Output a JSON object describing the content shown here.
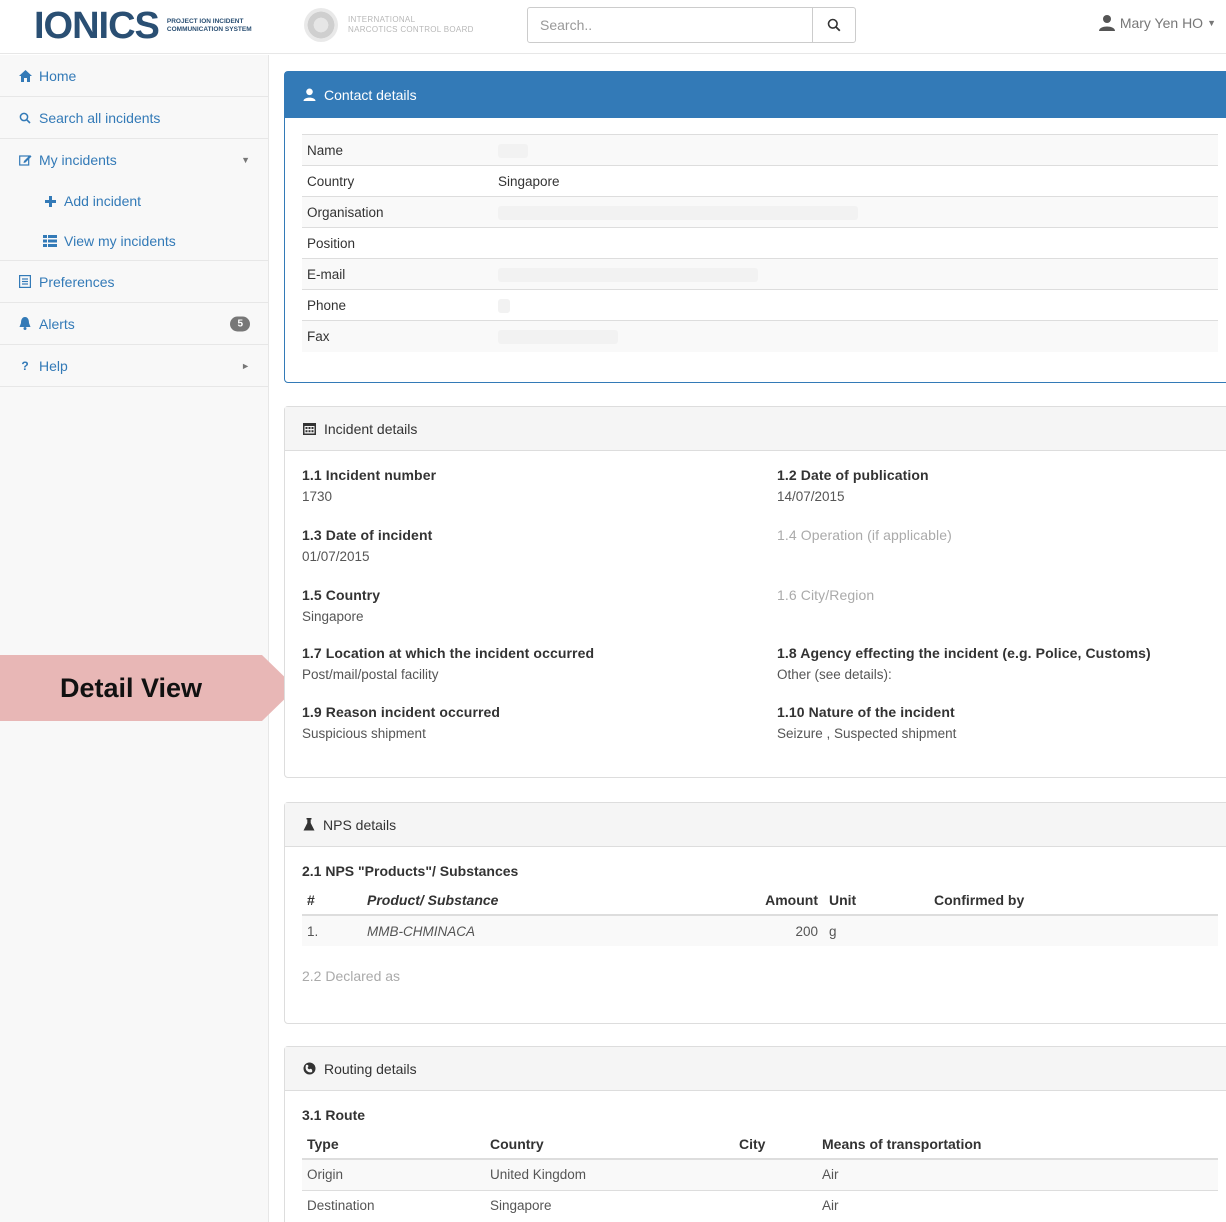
{
  "header": {
    "logo_text": "IONICS",
    "logo_sub_line1": "Project ION Incident",
    "logo_sub_line2": "Communication System",
    "incb_line1": "International",
    "incb_line2": "Narcotics Control Board",
    "search_placeholder": "Search..",
    "user_name": "Mary Yen HO"
  },
  "sidebar": {
    "home": "Home",
    "search_all": "Search all incidents",
    "my_incidents": "My incidents",
    "add_incident": "Add incident",
    "view_my_incidents": "View my incidents",
    "preferences": "Preferences",
    "alerts": "Alerts",
    "alerts_count": "5",
    "help": "Help"
  },
  "callout": {
    "text": "Detail View",
    "color": "#e8b7b6"
  },
  "contact": {
    "title": "Contact details",
    "rows": [
      {
        "label": "Name",
        "value": ""
      },
      {
        "label": "Country",
        "value": "Singapore"
      },
      {
        "label": "Organisation",
        "value": ""
      },
      {
        "label": "Position",
        "value": ""
      },
      {
        "label": "E-mail",
        "value": ""
      },
      {
        "label": "Phone",
        "value": ""
      },
      {
        "label": "Fax",
        "value": ""
      }
    ]
  },
  "incident": {
    "title": "Incident details",
    "f1_1": {
      "label": "1.1 Incident number",
      "value": "1730"
    },
    "f1_2": {
      "label": "1.2 Date of publication",
      "value": "14/07/2015"
    },
    "f1_3": {
      "label": "1.3 Date of incident",
      "value": "01/07/2015"
    },
    "f1_4": {
      "label": "1.4 Operation (if applicable)",
      "value": ""
    },
    "f1_5": {
      "label": "1.5 Country",
      "value": "Singapore"
    },
    "f1_6": {
      "label": "1.6 City/Region",
      "value": ""
    },
    "f1_7": {
      "label": "1.7 Location at which the incident occurred",
      "value": "Post/mail/postal facility"
    },
    "f1_8": {
      "label": "1.8 Agency effecting the incident (e.g. Police, Customs)",
      "value": "Other (see details):"
    },
    "f1_9": {
      "label": "1.9 Reason incident occurred",
      "value": "Suspicious shipment"
    },
    "f1_10": {
      "label": "1.10 Nature of the incident",
      "value": "Seizure , Suspected shipment"
    }
  },
  "nps": {
    "title": "NPS details",
    "section_2_1": "2.1 NPS \"Products\"/ Substances",
    "columns": {
      "num": "#",
      "product": "Product/ Substance",
      "amount": "Amount",
      "unit": "Unit",
      "confirmed": "Confirmed by"
    },
    "rows": [
      {
        "num": "1.",
        "product": "MMB-CHMINACA",
        "amount": "200",
        "unit": "g",
        "confirmed": ""
      }
    ],
    "section_2_2": "2.2 Declared as"
  },
  "routing": {
    "title": "Routing details",
    "section_3_1": "3.1 Route",
    "columns": {
      "type": "Type",
      "country": "Country",
      "city": "City",
      "means": "Means of transportation"
    },
    "rows": [
      {
        "type": "Origin",
        "country": "United Kingdom",
        "city": "",
        "means": "Air"
      },
      {
        "type": "Destination",
        "country": "Singapore",
        "city": "",
        "means": "Air"
      }
    ]
  }
}
